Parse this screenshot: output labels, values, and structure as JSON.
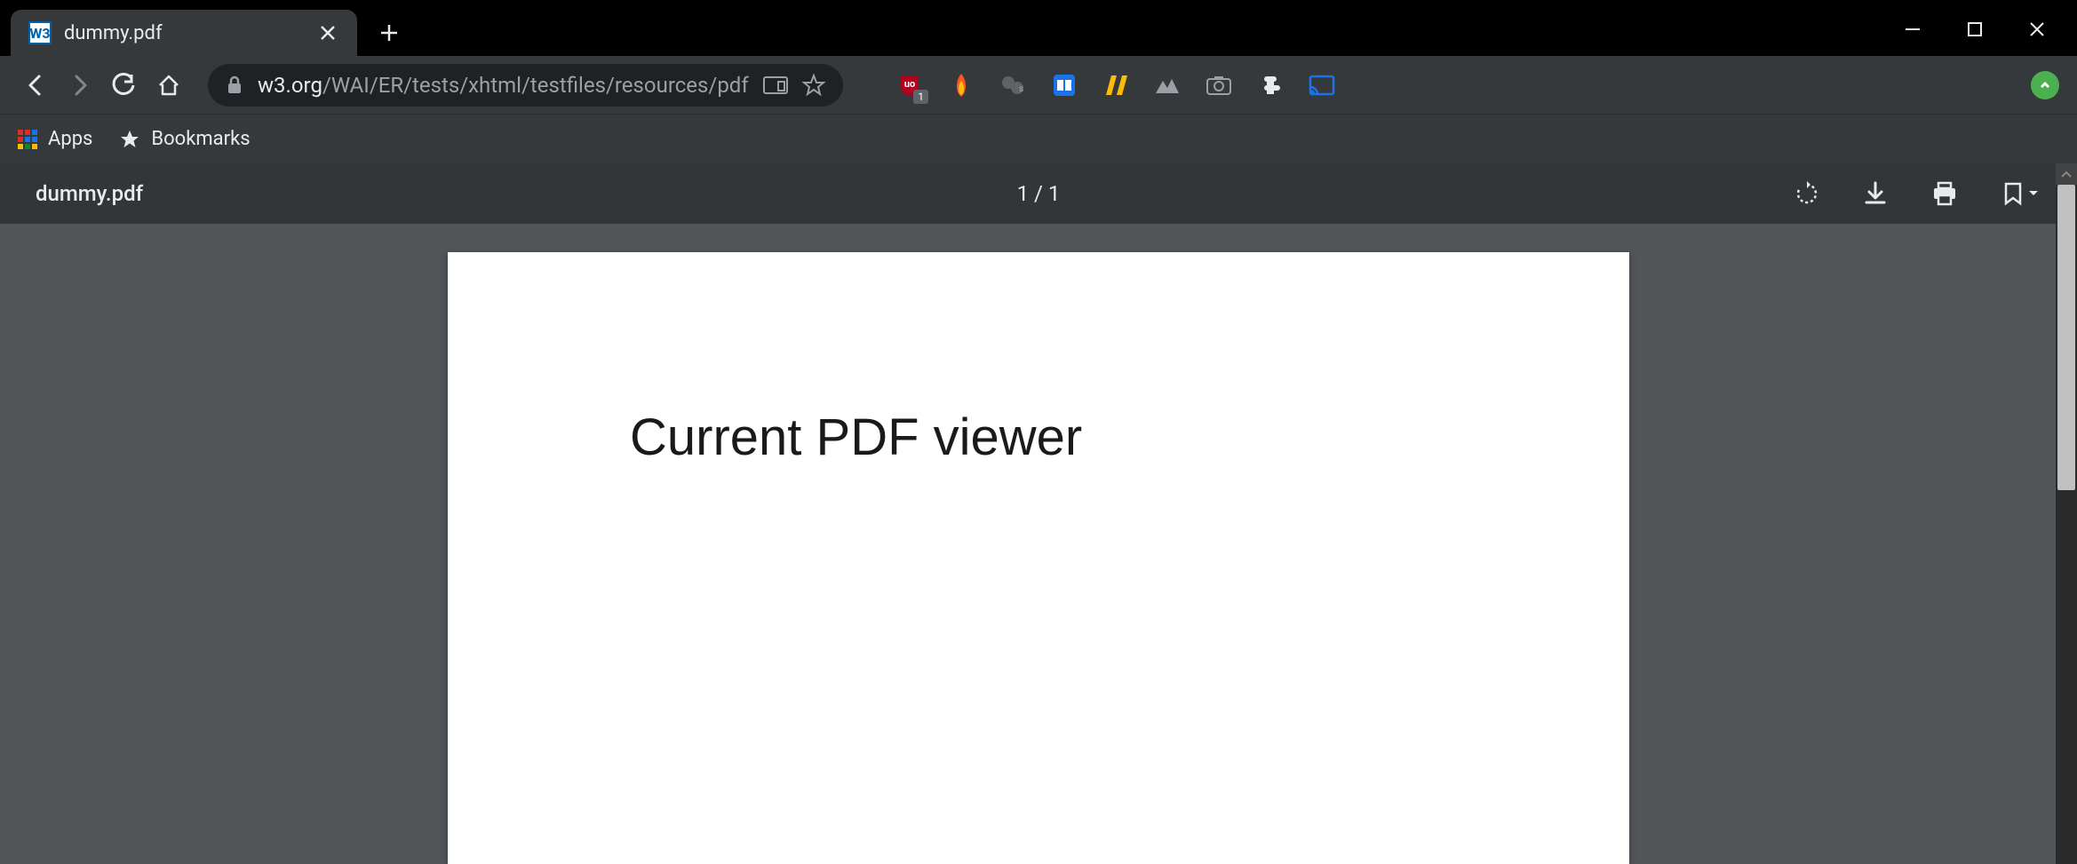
{
  "window": {
    "tab_title": "dummy.pdf",
    "favicon_text": "W3"
  },
  "navbar": {
    "url_host": "w3.org",
    "url_path": "/WAI/ER/tests/xhtml/testfiles/resources/pdf..."
  },
  "bookmarks": {
    "apps_label": "Apps",
    "bookmarks_label": "Bookmarks"
  },
  "extensions": {
    "ublock_badge": "1"
  },
  "pdf_viewer": {
    "filename": "dummy.pdf",
    "page_indicator": "1 / 1",
    "page_content": "Current PDF viewer"
  }
}
